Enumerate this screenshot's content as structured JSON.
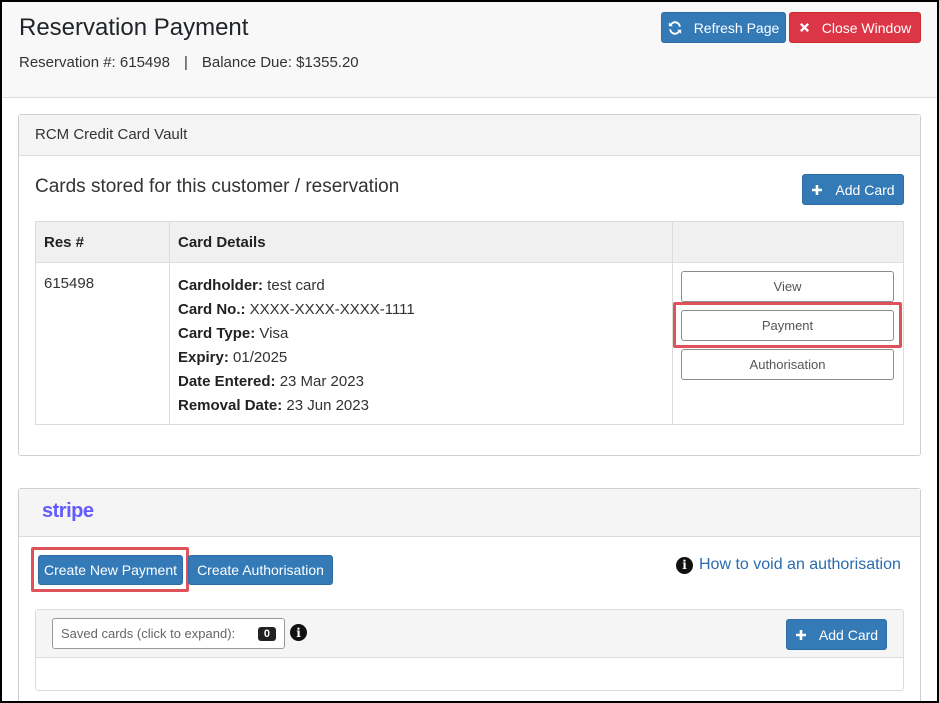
{
  "header": {
    "title": "Reservation Payment",
    "reservation_label": "Reservation #: 615498",
    "separator": "|",
    "balance_label": "Balance Due: $1355.20",
    "refresh_label": "Refresh Page",
    "close_label": "Close Window"
  },
  "vault": {
    "heading": "RCM Credit Card Vault",
    "title": "Cards stored for this customer / reservation",
    "add_card_label": "Add Card",
    "table": {
      "headers": [
        "Res #",
        "Card Details",
        ""
      ],
      "rows": [
        {
          "res_no": "615498",
          "details": [
            {
              "label": "Cardholder:",
              "value": " test card"
            },
            {
              "label": "Card No.:",
              "value": " XXXX-XXXX-XXXX-1111"
            },
            {
              "label": "Card Type:",
              "value": " Visa"
            },
            {
              "label": "Expiry:",
              "value": " 01/2025"
            },
            {
              "label": "Date Entered:",
              "value": " 23 Mar 2023"
            },
            {
              "label": "Removal Date:",
              "value": " 23 Jun 2023"
            }
          ],
          "actions": {
            "view": "View",
            "payment": "Payment",
            "authorisation": "Authorisation"
          }
        }
      ]
    }
  },
  "stripe": {
    "logo": "stripe",
    "create_payment_label": "Create New Payment",
    "create_auth_label": "Create Authorisation",
    "void_link_label": "How to void an authorisation",
    "saved_cards_label": "Saved cards (click to expand):",
    "saved_cards_count": "0",
    "add_card_label": "Add Card"
  },
  "colors": {
    "primary": "#337ab7",
    "danger": "#dc3545",
    "highlight": "#e0525a",
    "stripe_brand": "#635bff",
    "link": "#2a6bb0"
  }
}
